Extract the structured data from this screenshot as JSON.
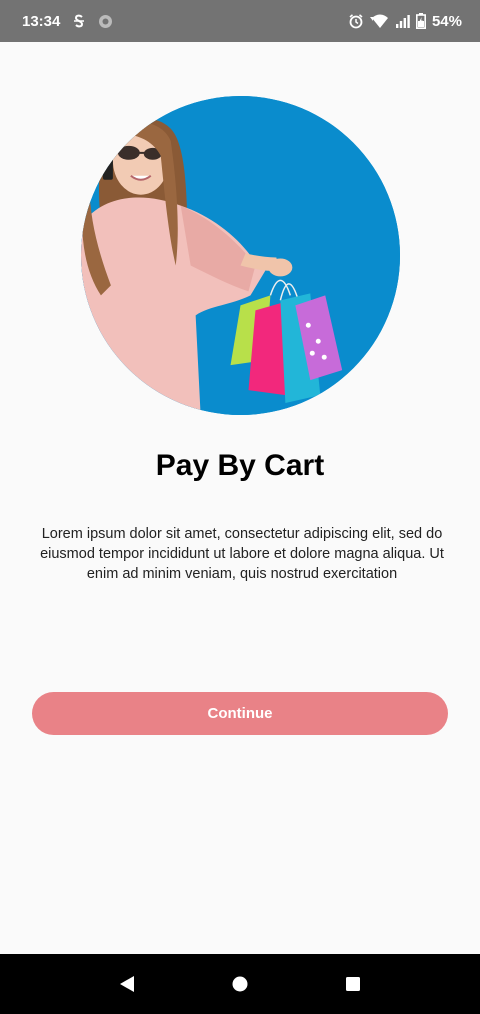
{
  "status_bar": {
    "time": "13:34",
    "battery": "54%",
    "icons": [
      "sim-icon",
      "data-saver-icon",
      "alarm-icon",
      "wifi-icon",
      "signal-icon",
      "battery-icon"
    ]
  },
  "onboarding": {
    "title": "Pay By Cart",
    "description": "Lorem ipsum dolor sit amet, consectetur adipiscing elit, sed do eiusmod tempor incididunt ut labore et dolore magna aliqua. Ut enim ad minim veniam, quis nostrud exercitation",
    "continue_label": "Continue"
  },
  "colors": {
    "accent": "#e98287",
    "hero_background": "#0a8ccd",
    "status_bar": "#737373",
    "nav_bar": "#000000"
  },
  "nav_bar": {
    "buttons": [
      "back-icon",
      "home-icon",
      "recents-icon"
    ]
  }
}
